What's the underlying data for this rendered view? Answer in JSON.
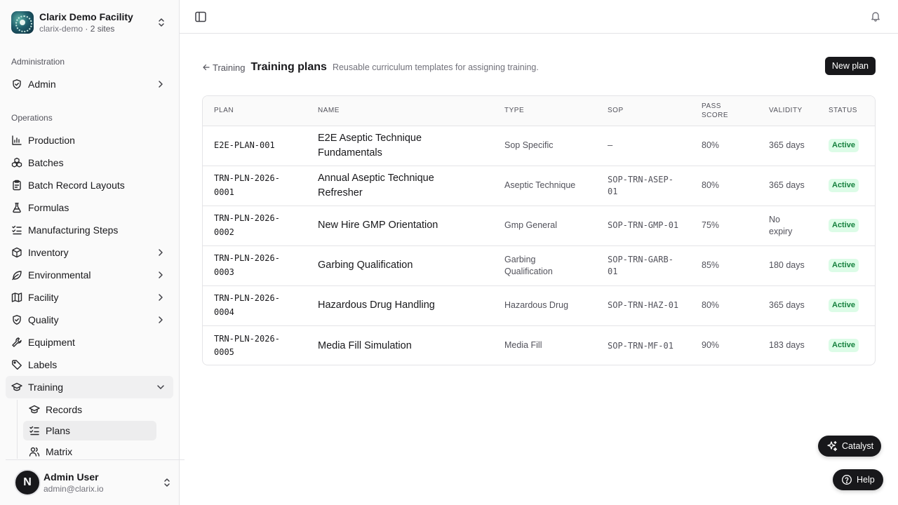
{
  "org": {
    "name": "Clarix Demo Facility",
    "slug": "clarix-demo",
    "sites": "· 2 sites"
  },
  "sidebar": {
    "sections": {
      "administration": "Administration",
      "operations": "Operations"
    },
    "admin": {
      "label": "Admin",
      "icon": "shield-check-icon"
    },
    "items": [
      {
        "label": "Production",
        "icon": "chart-icon"
      },
      {
        "label": "Batches",
        "icon": "boxes-icon"
      },
      {
        "label": "Batch Record Layouts",
        "icon": "clipboard-icon"
      },
      {
        "label": "Formulas",
        "icon": "flask-icon"
      },
      {
        "label": "Manufacturing Steps",
        "icon": "list-checks-icon"
      },
      {
        "label": "Inventory",
        "icon": "package-icon"
      },
      {
        "label": "Environmental",
        "icon": "leaf-icon"
      },
      {
        "label": "Facility",
        "icon": "map-icon"
      },
      {
        "label": "Quality",
        "icon": "shield-check-icon"
      },
      {
        "label": "Equipment",
        "icon": "wrench-icon"
      },
      {
        "label": "Labels",
        "icon": "tag-icon"
      },
      {
        "label": "Training",
        "icon": "graduation-cap-icon"
      }
    ],
    "training_sub": [
      {
        "label": "Records",
        "icon": "graduation-cap-icon"
      },
      {
        "label": "Plans",
        "icon": "list-checks-icon"
      },
      {
        "label": "Matrix",
        "icon": "users-icon"
      }
    ]
  },
  "user": {
    "initial": "N",
    "name": "Admin User",
    "email": "admin@clarix.io"
  },
  "header": {
    "back_label": "Training",
    "title": "Training plans",
    "subtitle": "Reusable curriculum templates for assigning training.",
    "new_button": "New plan"
  },
  "table": {
    "columns": {
      "plan": "Plan",
      "name": "Name",
      "type": "Type",
      "sop": "SOP",
      "pass_score": "Pass score",
      "validity": "Validity",
      "status": "Status"
    },
    "rows": [
      {
        "plan": "E2E-PLAN-001",
        "name": "E2E Aseptic Technique Fundamentals",
        "type": "Sop Specific",
        "sop": "—",
        "pass_score": "80%",
        "validity": "365 days",
        "status": "Active"
      },
      {
        "plan": "TRN-PLN-2026-0001",
        "name": "Annual Aseptic Technique Refresher",
        "type": "Aseptic Technique",
        "sop": "SOP-TRN-ASEP-01",
        "pass_score": "80%",
        "validity": "365 days",
        "status": "Active"
      },
      {
        "plan": "TRN-PLN-2026-0002",
        "name": "New Hire GMP Orientation",
        "type": "Gmp General",
        "sop": "SOP-TRN-GMP-01",
        "pass_score": "75%",
        "validity": "No expiry",
        "status": "Active"
      },
      {
        "plan": "TRN-PLN-2026-0003",
        "name": "Garbing Qualification",
        "type": "Garbing Qualification",
        "sop": "SOP-TRN-GARB-01",
        "pass_score": "85%",
        "validity": "180 days",
        "status": "Active"
      },
      {
        "plan": "TRN-PLN-2026-0004",
        "name": "Hazardous Drug Handling",
        "type": "Hazardous Drug",
        "sop": "SOP-TRN-HAZ-01",
        "pass_score": "80%",
        "validity": "365 days",
        "status": "Active"
      },
      {
        "plan": "TRN-PLN-2026-0005",
        "name": "Media Fill Simulation",
        "type": "Media Fill",
        "sop": "SOP-TRN-MF-01",
        "pass_score": "90%",
        "validity": "183 days",
        "status": "Active"
      }
    ]
  },
  "floating": {
    "catalyst": "Catalyst",
    "help": "Help"
  },
  "colors": {
    "accent": "#18181b",
    "active_badge_bg": "#dcfce7",
    "active_badge_text": "#15803d"
  }
}
